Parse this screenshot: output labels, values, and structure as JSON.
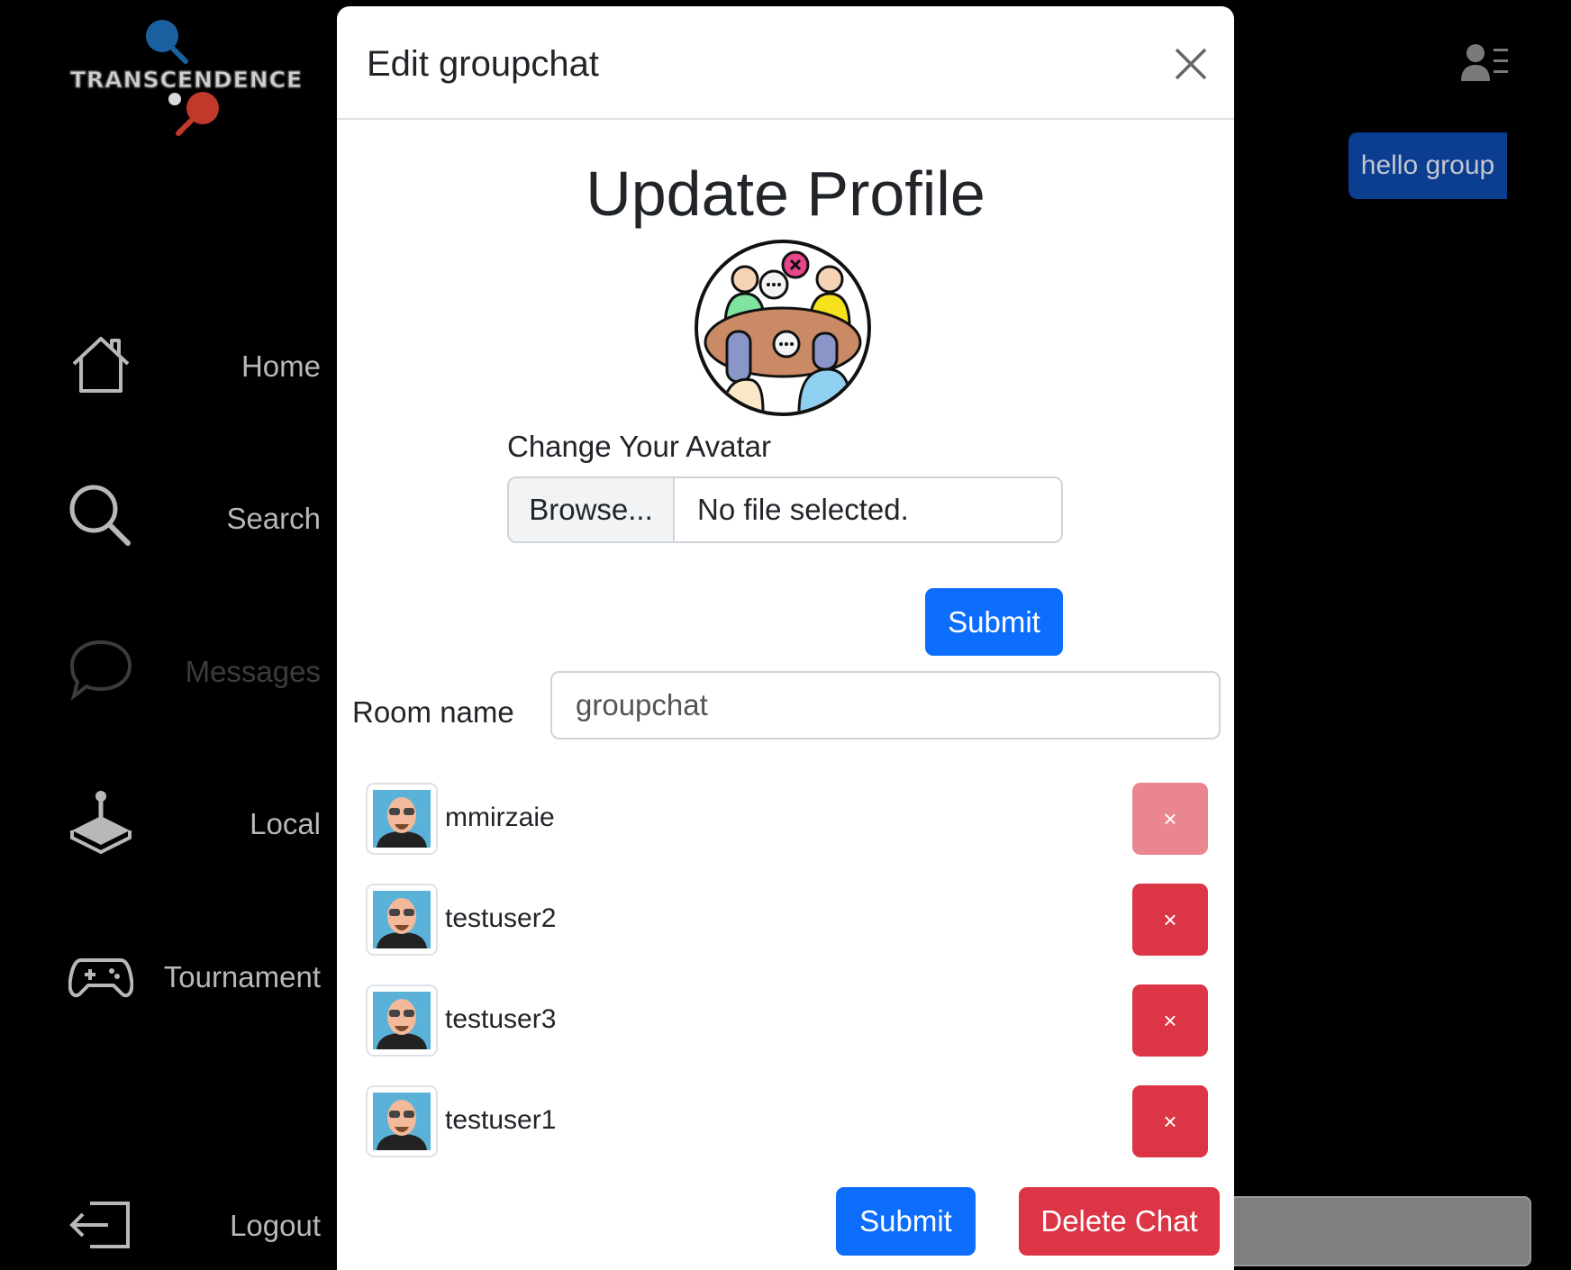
{
  "app": {
    "logo_text": "TRANSCENDENCE"
  },
  "sidebar": {
    "items": [
      {
        "label": "Home",
        "icon": "home-icon"
      },
      {
        "label": "Search",
        "icon": "search-icon"
      },
      {
        "label": "Messages",
        "icon": "chat-bubble-icon"
      },
      {
        "label": "Local",
        "icon": "joystick-icon"
      },
      {
        "label": "Tournament",
        "icon": "gamepad-icon"
      },
      {
        "label": "Logout",
        "icon": "logout-icon"
      }
    ]
  },
  "chat": {
    "message": "hello group"
  },
  "modal": {
    "title": "Edit groupchat",
    "heading": "Update Profile",
    "avatar_label": "Change Your Avatar",
    "browse_label": "Browse...",
    "file_status": "No file selected.",
    "avatar_submit": "Submit",
    "room_label": "Room name",
    "room_value": "groupchat",
    "members": [
      {
        "name": "mmirzaie",
        "remove": "×"
      },
      {
        "name": "testuser2",
        "remove": "×"
      },
      {
        "name": "testuser3",
        "remove": "×"
      },
      {
        "name": "testuser1",
        "remove": "×"
      }
    ],
    "submit_label": "Submit",
    "delete_label": "Delete Chat"
  },
  "colors": {
    "primary": "#0d6efd",
    "danger": "#dc3545",
    "danger_faded": "#ea868f",
    "message_bubble": "#0b3d91"
  }
}
